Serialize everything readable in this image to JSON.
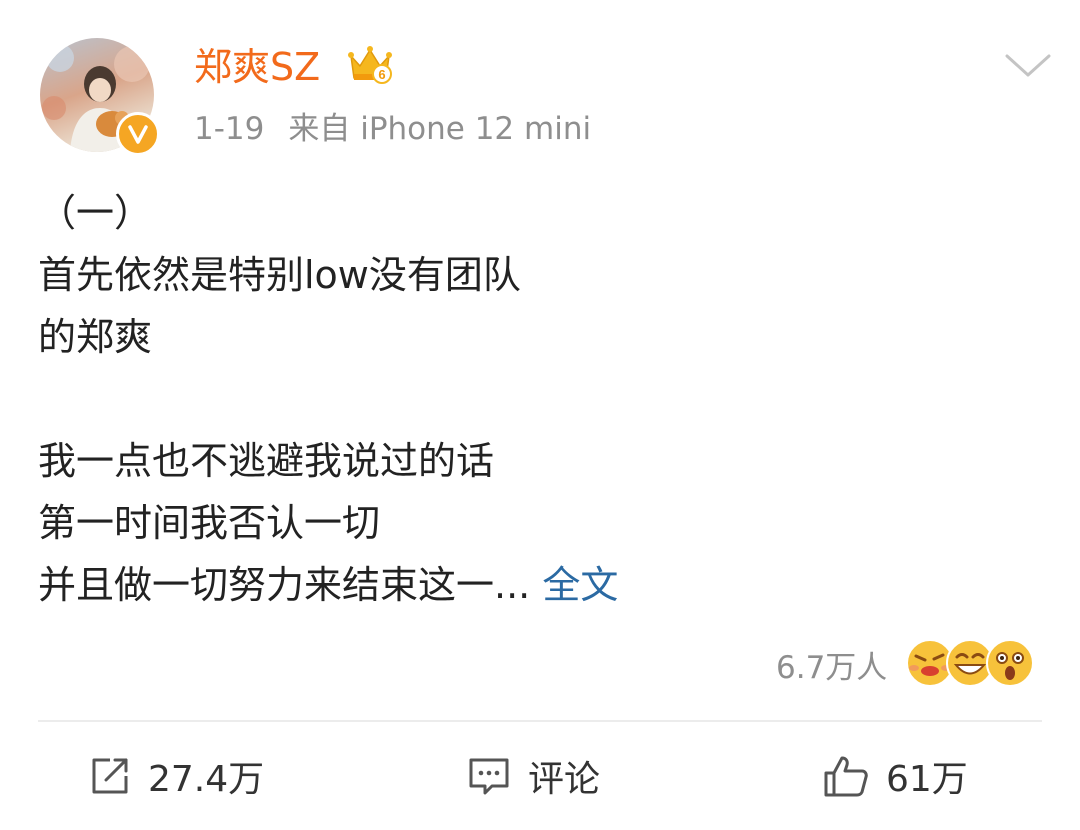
{
  "post": {
    "author": {
      "name": "郑爽SZ",
      "crown_level": "6"
    },
    "date": "1-19",
    "source": "来自 iPhone 12 mini",
    "lines": [
      "（一）",
      "首先依然是特别low没有团队",
      "的郑爽",
      "",
      "我一点也不逃避我说过的话",
      "第一时间我否认一切",
      "并且做一切努力来结束这一..."
    ],
    "read_more": "全文",
    "reactions": {
      "count": "6.7万人",
      "emojis": [
        "angry-face-icon",
        "grinning-face-icon",
        "shocked-face-icon"
      ]
    }
  },
  "actions": {
    "repost": "27.4万",
    "comment": "评论",
    "like": "61万"
  },
  "colors": {
    "username": "#f26a1b",
    "link": "#2b6aa3",
    "meta": "#8e8e8e",
    "badge": "#f5a623"
  }
}
